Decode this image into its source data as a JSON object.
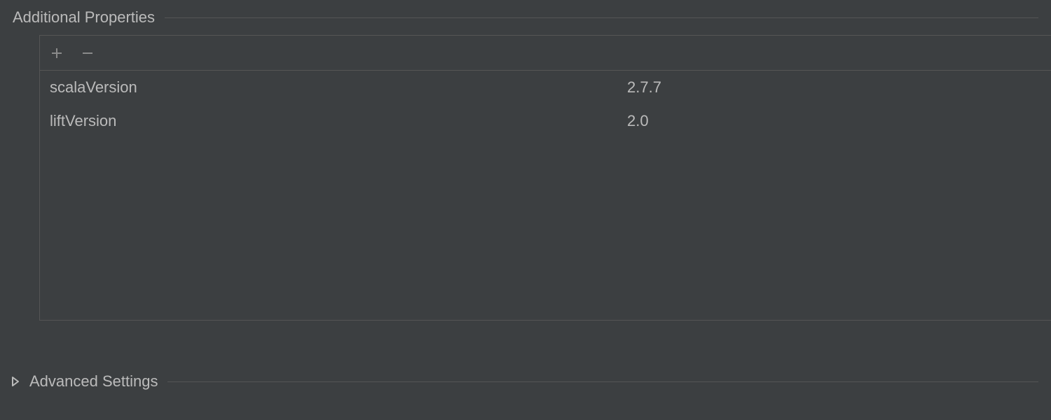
{
  "sections": {
    "additionalProperties": {
      "title": "Additional Properties",
      "toolbar": {
        "addLabel": "add",
        "removeLabel": "remove"
      },
      "rows": [
        {
          "key": "scalaVersion",
          "value": "2.7.7"
        },
        {
          "key": "liftVersion",
          "value": "2.0"
        }
      ]
    },
    "advancedSettings": {
      "title": "Advanced Settings",
      "expanded": false
    }
  }
}
